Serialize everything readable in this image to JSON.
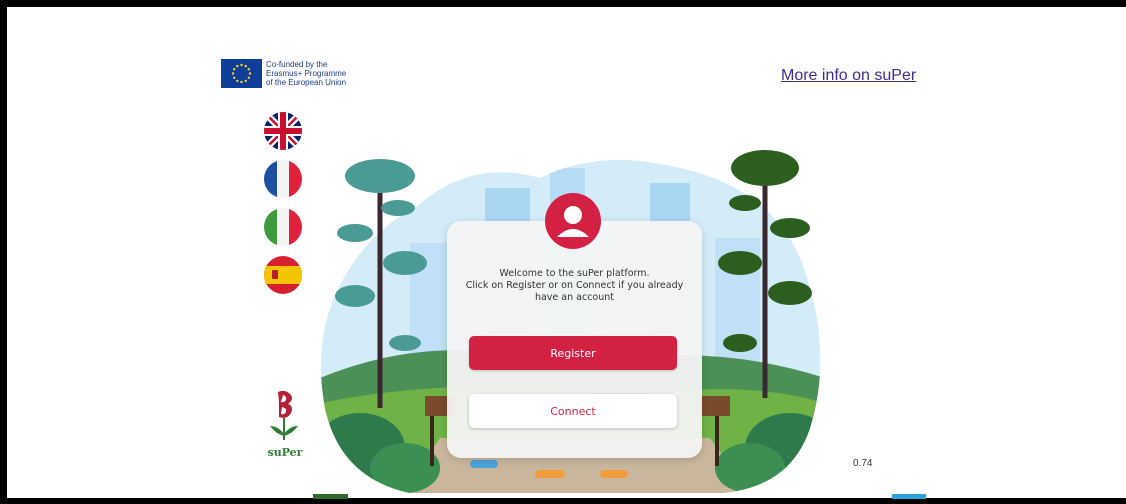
{
  "eu": {
    "line1": "Co-funded by the",
    "line2": "Erasmus+ Programme",
    "line3": "of the European Union"
  },
  "header": {
    "more_info_link": "More info on suPer"
  },
  "languages": [
    "english-flag",
    "french-flag",
    "italian-flag",
    "spanish-flag"
  ],
  "card": {
    "welcome_line1": "Welcome to the suPer platform.",
    "welcome_line2": "Click on Register or on Connect if you already",
    "welcome_line3": "have an account",
    "register_label": "Register",
    "connect_label": "Connect"
  },
  "logo": {
    "text": "suPer"
  },
  "zoom": {
    "value": "0.74"
  },
  "colors": {
    "accent": "#d22143",
    "link": "#3f2c8e",
    "eu_blue": "#0f3d9a"
  }
}
